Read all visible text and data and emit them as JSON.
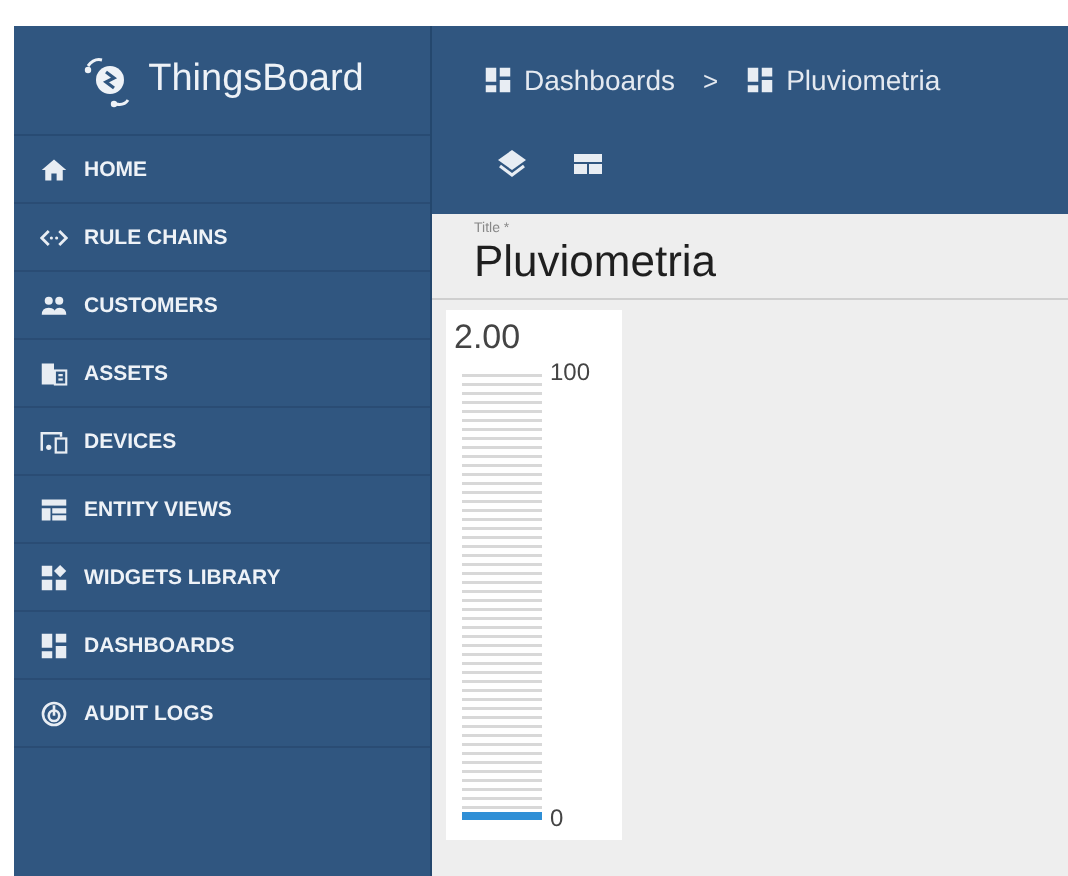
{
  "sidebar": {
    "brand": "ThingsBoard",
    "items": [
      {
        "label": "HOME"
      },
      {
        "label": "RULE CHAINS"
      },
      {
        "label": "CUSTOMERS"
      },
      {
        "label": "ASSETS"
      },
      {
        "label": "DEVICES"
      },
      {
        "label": "ENTITY VIEWS"
      },
      {
        "label": "WIDGETS LIBRARY"
      },
      {
        "label": "DASHBOARDS"
      },
      {
        "label": "AUDIT LOGS"
      }
    ]
  },
  "breadcrumbs": [
    {
      "label": "Dashboards"
    },
    {
      "separator": ">",
      "label": "Pluviometria"
    }
  ],
  "title_field": {
    "label": "Title *",
    "value": "Pluviometria"
  },
  "gauge": {
    "value": "2.00",
    "max": "100",
    "min": "0",
    "level": 0.02
  }
}
